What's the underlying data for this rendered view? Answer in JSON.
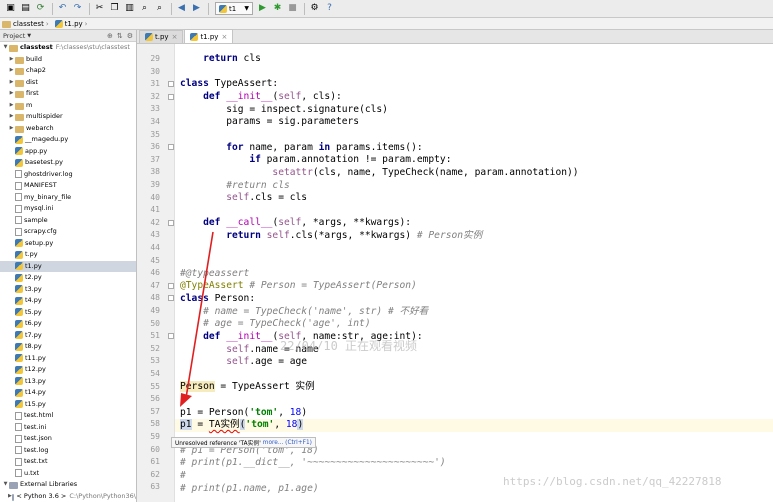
{
  "toolbar": {
    "run_config": "t1",
    "icons": [
      "open-icon",
      "save-icon",
      "sync-icon",
      "undo-icon",
      "redo-icon",
      "cut-icon",
      "copy-icon",
      "paste-icon",
      "find-icon",
      "replace-icon",
      "back-icon",
      "forward-icon",
      "run-config-icon",
      "run-icon",
      "debug-icon",
      "stop-icon",
      "settings-icon",
      "help-icon"
    ]
  },
  "nav": {
    "project": "classtest",
    "file": "t1.py"
  },
  "sidebar": {
    "header": "Project",
    "root": {
      "name": "classtest",
      "path": "F:\\classes\\stu\\classtest"
    },
    "items": [
      {
        "name": "build",
        "type": "folder"
      },
      {
        "name": "chap2",
        "type": "folder"
      },
      {
        "name": "dist",
        "type": "folder"
      },
      {
        "name": "first",
        "type": "folder"
      },
      {
        "name": "m",
        "type": "folder"
      },
      {
        "name": "multispider",
        "type": "folder"
      },
      {
        "name": "webarch",
        "type": "folder"
      },
      {
        "name": "__magedu.py",
        "type": "py"
      },
      {
        "name": "app.py",
        "type": "py"
      },
      {
        "name": "basetest.py",
        "type": "py"
      },
      {
        "name": "ghostdriver.log",
        "type": "txt"
      },
      {
        "name": "MANIFEST",
        "type": "txt"
      },
      {
        "name": "my_binary_file",
        "type": "txt"
      },
      {
        "name": "mysql.ini",
        "type": "txt"
      },
      {
        "name": "sample",
        "type": "txt"
      },
      {
        "name": "scrapy.cfg",
        "type": "txt"
      },
      {
        "name": "setup.py",
        "type": "py"
      },
      {
        "name": "t.py",
        "type": "py"
      },
      {
        "name": "t1.py",
        "type": "py",
        "selected": true
      },
      {
        "name": "t2.py",
        "type": "py"
      },
      {
        "name": "t3.py",
        "type": "py"
      },
      {
        "name": "t4.py",
        "type": "py"
      },
      {
        "name": "t5.py",
        "type": "py"
      },
      {
        "name": "t6.py",
        "type": "py"
      },
      {
        "name": "t7.py",
        "type": "py"
      },
      {
        "name": "t8.py",
        "type": "py"
      },
      {
        "name": "t11.py",
        "type": "py"
      },
      {
        "name": "t12.py",
        "type": "py"
      },
      {
        "name": "t13.py",
        "type": "py"
      },
      {
        "name": "t14.py",
        "type": "py"
      },
      {
        "name": "t15.py",
        "type": "py"
      },
      {
        "name": "test.html",
        "type": "txt"
      },
      {
        "name": "test.ini",
        "type": "txt"
      },
      {
        "name": "test.json",
        "type": "txt"
      },
      {
        "name": "test.log",
        "type": "txt"
      },
      {
        "name": "test.txt",
        "type": "txt"
      },
      {
        "name": "u.txt",
        "type": "txt"
      }
    ],
    "external": "External Libraries",
    "sdk": {
      "name": "< Python 3.6 >",
      "path": "C:\\Python\\Python36\\"
    }
  },
  "tabs": [
    {
      "label": "t.py",
      "active": false
    },
    {
      "label": "t1.py",
      "active": true
    }
  ],
  "line_numbers": [
    29,
    30,
    31,
    32,
    33,
    34,
    35,
    36,
    37,
    38,
    39,
    40,
    41,
    42,
    43,
    44,
    45,
    46,
    47,
    48,
    49,
    50,
    51,
    52,
    53,
    54,
    55,
    56,
    57,
    58,
    59,
    60,
    61,
    62,
    63
  ],
  "code": {
    "l29_kw": "return",
    "l29_v": " cls",
    "l31_kw": "class",
    "l31_rest": " TypeAssert:",
    "l32_kw": "def",
    "l32_fn": "__init__",
    "l32_a": "(",
    "l32_self": "self",
    "l32_b": ", cls):",
    "l33": "sig = inspect.signature(cls)",
    "l34": "params = sig.parameters",
    "l36_for": "for",
    "l36_a": " name, param ",
    "l36_in": "in",
    "l36_b": " params.items():",
    "l37_if": "if",
    "l37_a": " param.annotation != param.empty:",
    "l38_fn": "setattr",
    "l38_a": "(cls, name, TypeCheck(name, param.annotation))",
    "l39": "#return cls",
    "l40_self": "self",
    "l40_a": ".cls = cls",
    "l42_kw": "def",
    "l42_fn": "__call__",
    "l42_a": "(",
    "l42_self": "self",
    "l42_b": ", *args, **kwargs):",
    "l43_kw": "return",
    "l43_sp": " ",
    "l43_self": "self",
    "l43_a": ".cls(*args, **kwargs) ",
    "l43_c": "# Person实例",
    "l46": "#@typeassert",
    "l47_dec": "@TypeAssert",
    "l47_c": " # Person = TypeAssert(Person)",
    "l48_kw": "class",
    "l48_a": " Person:",
    "l49": "# name = TypeCheck('name', str) # 不好看",
    "l50": "# age = TypeCheck('age', int)",
    "l51_kw": "def",
    "l51_fn": "__init__",
    "l51_a": "(",
    "l51_self": "self",
    "l51_b": ", name:",
    "l51_str": "str",
    "l51_c": ", age:",
    "l51_int": "int",
    "l51_d": "):",
    "l52_self": "self",
    "l52_a": ".name = name",
    "l53_self": "self",
    "l53_a": ".age = age",
    "l55_person": "Person",
    "l55_a": " = TypeAssert 实例",
    "l57_a": "p1 = Person(",
    "l57_s": "'tom'",
    "l57_b": ", ",
    "l57_n": "18",
    "l57_c": ")",
    "l58_a": "p1",
    "l58_b": " = ",
    "l58_err": "TA实例",
    "l58_c": "(",
    "l58_s": "'tom'",
    "l58_d": ", ",
    "l58_n": "18",
    "l58_e": ")",
    "l60": "# p1 = Person('tom', 18)",
    "l61": "# print(p1.__dict__, '~~~~~~~~~~~~~~~~~~~~~~')",
    "l62": "#",
    "l63": "# print(p1.name, p1.age)"
  },
  "tooltip": {
    "text": "Unresolved reference 'TA实例'",
    "more": "more... (Ctrl+F1)"
  },
  "watermarks": {
    "center": "22/04/10 正在观看视频",
    "url": "https://blog.csdn.net/qq_42227818"
  },
  "colors": {
    "keyword": "#000080",
    "comment": "#808080",
    "string": "#008000",
    "self": "#94558d",
    "decorator": "#808000",
    "number": "#0000ff",
    "arrow": "#e02020"
  }
}
